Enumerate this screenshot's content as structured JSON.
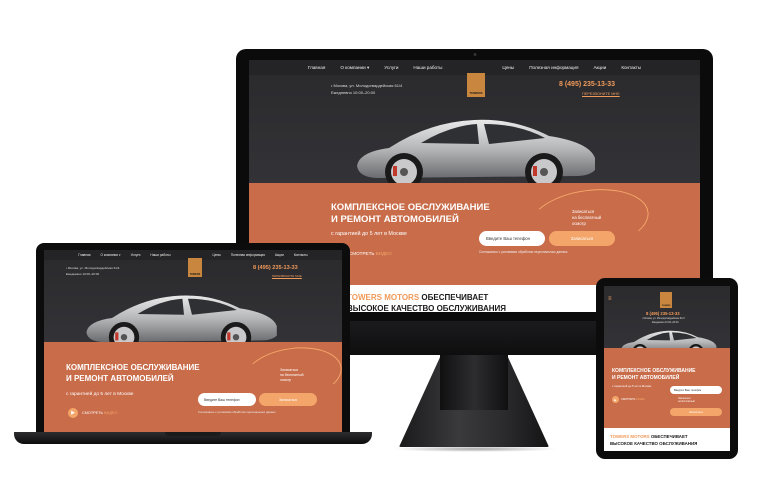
{
  "site": {
    "nav": [
      "Главная",
      "О компании",
      "Услуги",
      "Наши работы",
      "Цены",
      "Полезная информация",
      "Акции",
      "Контакты"
    ],
    "nav_dropdown_marker": "▾",
    "address": "• Москва, ул. Молодогвардейская 61/4",
    "hours": "Ежедневно 10:00–20:00",
    "logo_text": "TOWERS",
    "logo_sub": "MOTORS",
    "phone": "8 (495) 235-13-33",
    "callback": "ПЕРЕЗВОНИТЕ МНЕ",
    "title_line1": "Комплексное обслуживание",
    "title_line2": "и ремонт автомобилей",
    "subtitle": "с гарантией до 5 лет в Москве",
    "input_placeholder": "Введите Ваш телефон",
    "submit_label": "Записаться",
    "diag_note_line1": "Записаться",
    "diag_note_line2": "на бесплатный",
    "diag_note_line3": "осмотр",
    "watch_label_a": "СМОТРЕТЬ",
    "watch_label_b": "ВИДЕО",
    "agree_text": "Соглашаюсь с условиями обработки персональных данных",
    "promo_brand": "TOWERS MOTORS",
    "promo_line1_rest": "обеспечивает",
    "promo_line2": "высокое качество обслуживания"
  },
  "colors": {
    "accent": "#f4a66a",
    "terracotta": "#c86c4a",
    "dark": "#2a2a2c"
  }
}
